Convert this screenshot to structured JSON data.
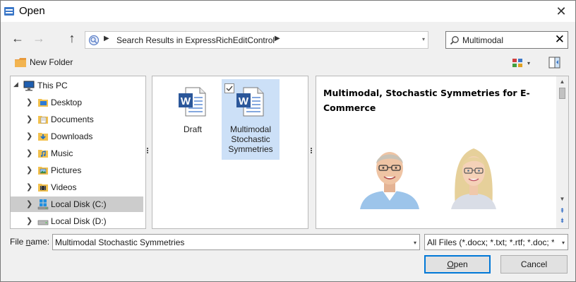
{
  "window": {
    "title": "Open"
  },
  "icons": {
    "app": "open-dialog-icon",
    "close": "close-icon",
    "back": "back-arrow-icon",
    "forward": "forward-arrow-icon",
    "up": "up-arrow-icon",
    "search": "search-icon",
    "clear": "clear-icon",
    "new_folder": "folder-icon",
    "view": "view-options-icon",
    "preview_pane": "preview-pane-icon"
  },
  "navigation": {
    "back_glyph": "←",
    "forward_glyph": "→",
    "up_glyph": "↑",
    "address": {
      "separator": "▶",
      "path": "Search Results in ExpressRichEditControl",
      "trailing_separator": "▶",
      "dropdown": "▾"
    },
    "search": {
      "value": "Multimodal",
      "clear_glyph": "✕"
    }
  },
  "toolbar": {
    "new_folder_label": "New Folder",
    "view_dropdown": "▾"
  },
  "tree": {
    "expanded_glyph": "◢",
    "collapsed_glyph": "❯",
    "items": [
      {
        "label": "This PC",
        "icon": "computer-icon"
      },
      {
        "label": "Desktop",
        "icon": "desktop-folder-icon"
      },
      {
        "label": "Documents",
        "icon": "documents-folder-icon"
      },
      {
        "label": "Downloads",
        "icon": "downloads-folder-icon"
      },
      {
        "label": "Music",
        "icon": "music-folder-icon"
      },
      {
        "label": "Pictures",
        "icon": "pictures-folder-icon"
      },
      {
        "label": "Videos",
        "icon": "videos-folder-icon"
      },
      {
        "label": "Local Disk (C:)",
        "icon": "windows-drive-icon"
      },
      {
        "label": "Local Disk (D:)",
        "icon": "drive-icon"
      }
    ]
  },
  "files": [
    {
      "name": "Draft",
      "icon": "word-document-icon"
    },
    {
      "name_lines": [
        "Multimodal",
        "Stochastic",
        "Symmetries"
      ],
      "icon": "word-document-icon",
      "checked": true
    }
  ],
  "preview": {
    "title": "Multimodal, Stochastic Symmetries for E-Commerce",
    "images": [
      "man-portrait-photo",
      "woman-portrait-photo"
    ],
    "scroll": {
      "up": "▲",
      "down": "▼",
      "page_up": "⇞",
      "page_down": "⇟"
    }
  },
  "footer": {
    "file_name_label_pre": "File ",
    "file_name_label_key": "n",
    "file_name_label_post": "ame:",
    "file_name_value": "Multimodal Stochastic Symmetries",
    "file_type_value": "All Files (*.docx; *.txt; *.rtf; *.doc; *.",
    "dropdown": "▾",
    "open_key": "O",
    "open_rest": "pen",
    "cancel_label": "Cancel"
  }
}
